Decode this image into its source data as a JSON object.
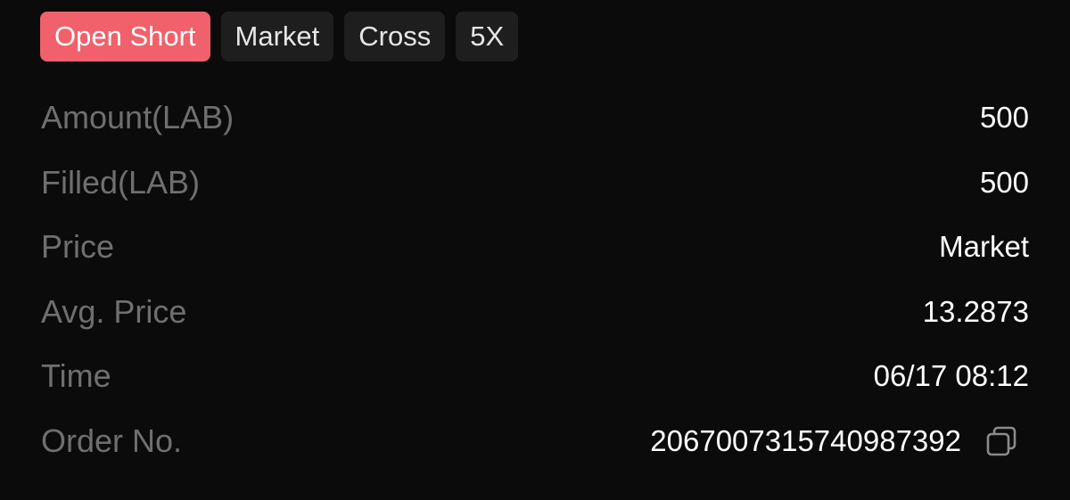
{
  "order_tags": {
    "side": "Open Short",
    "order_type": "Market",
    "margin_mode": "Cross",
    "leverage": "5X"
  },
  "details": [
    {
      "label": "Amount(LAB)",
      "value": "500"
    },
    {
      "label": "Filled(LAB)",
      "value": "500"
    },
    {
      "label": "Price",
      "value": "Market"
    },
    {
      "label": "Avg. Price",
      "value": "13.2873"
    },
    {
      "label": "Time",
      "value": "06/17 08:12"
    },
    {
      "label": "Order No.",
      "value": "2067007315740987392"
    }
  ],
  "icons": {
    "order_no_action": "copy-icon"
  },
  "colors": {
    "background": "#0b0b0b",
    "side_short": "#f0616b",
    "tag_background": "#1e1e1e",
    "label": "#6f6f6f",
    "value": "#ffffff"
  }
}
